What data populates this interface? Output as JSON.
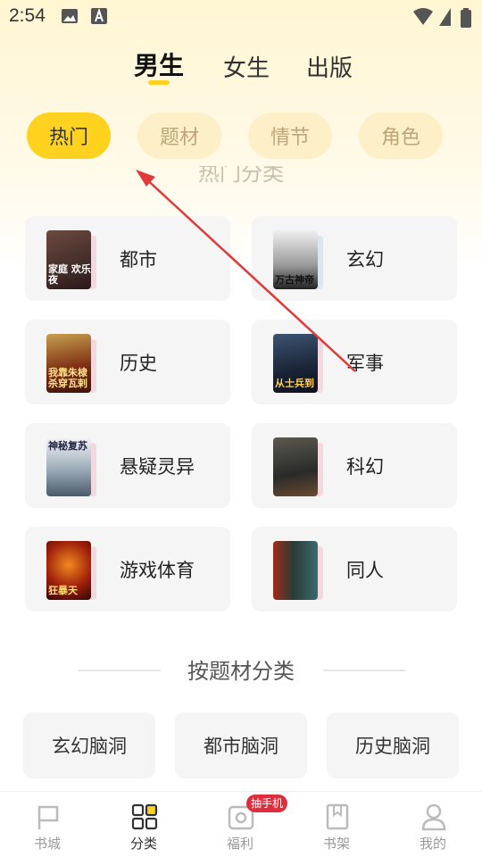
{
  "status": {
    "time": "2:54"
  },
  "gender_tabs": [
    {
      "label": "男生",
      "active": true
    },
    {
      "label": "女生",
      "active": false
    },
    {
      "label": "出版",
      "active": false
    }
  ],
  "filter_chips": [
    {
      "label": "热门",
      "active": true
    },
    {
      "label": "题材",
      "active": false
    },
    {
      "label": "情节",
      "active": false
    },
    {
      "label": "角色",
      "active": false
    }
  ],
  "hot_section": {
    "title": "热门分类"
  },
  "categories": [
    {
      "label": "都市",
      "cover_text": "家庭 欢乐夜",
      "cover_color": "#3a2a2a"
    },
    {
      "label": "玄幻",
      "cover_text": "万古神帝",
      "cover_color": "#d8d8d8"
    },
    {
      "label": "历史",
      "cover_text": "我靠朱棣 杀穿瓦剌",
      "cover_color": "#6a2a14"
    },
    {
      "label": "军事",
      "cover_text": "从士兵到",
      "cover_color": "#1e2e44"
    },
    {
      "label": "悬疑灵异",
      "cover_text": "神秘复苏",
      "cover_color": "#9aaab8"
    },
    {
      "label": "科幻",
      "cover_text": "",
      "cover_color": "#3a3a3a"
    },
    {
      "label": "游戏体育",
      "cover_text": "狂暴天",
      "cover_color": "#b42a12"
    },
    {
      "label": "同人",
      "cover_text": "",
      "cover_color": "#2a3c34"
    }
  ],
  "theme_section": {
    "title": "按题材分类"
  },
  "theme_chips": [
    "玄幻脑洞",
    "都市脑洞",
    "历史脑洞"
  ],
  "bottom_nav": [
    {
      "label": "书城",
      "icon": "flag-icon",
      "active": false
    },
    {
      "label": "分类",
      "icon": "grid-icon",
      "active": true
    },
    {
      "label": "福利",
      "icon": "gift-icon",
      "active": false,
      "badge": "抽手机"
    },
    {
      "label": "书架",
      "icon": "book-icon",
      "active": false
    },
    {
      "label": "我的",
      "icon": "user-icon",
      "active": false
    }
  ],
  "colors": {
    "accent": "#ffd21f",
    "badge": "#e02d3c",
    "arrow": "#e03a3a"
  }
}
